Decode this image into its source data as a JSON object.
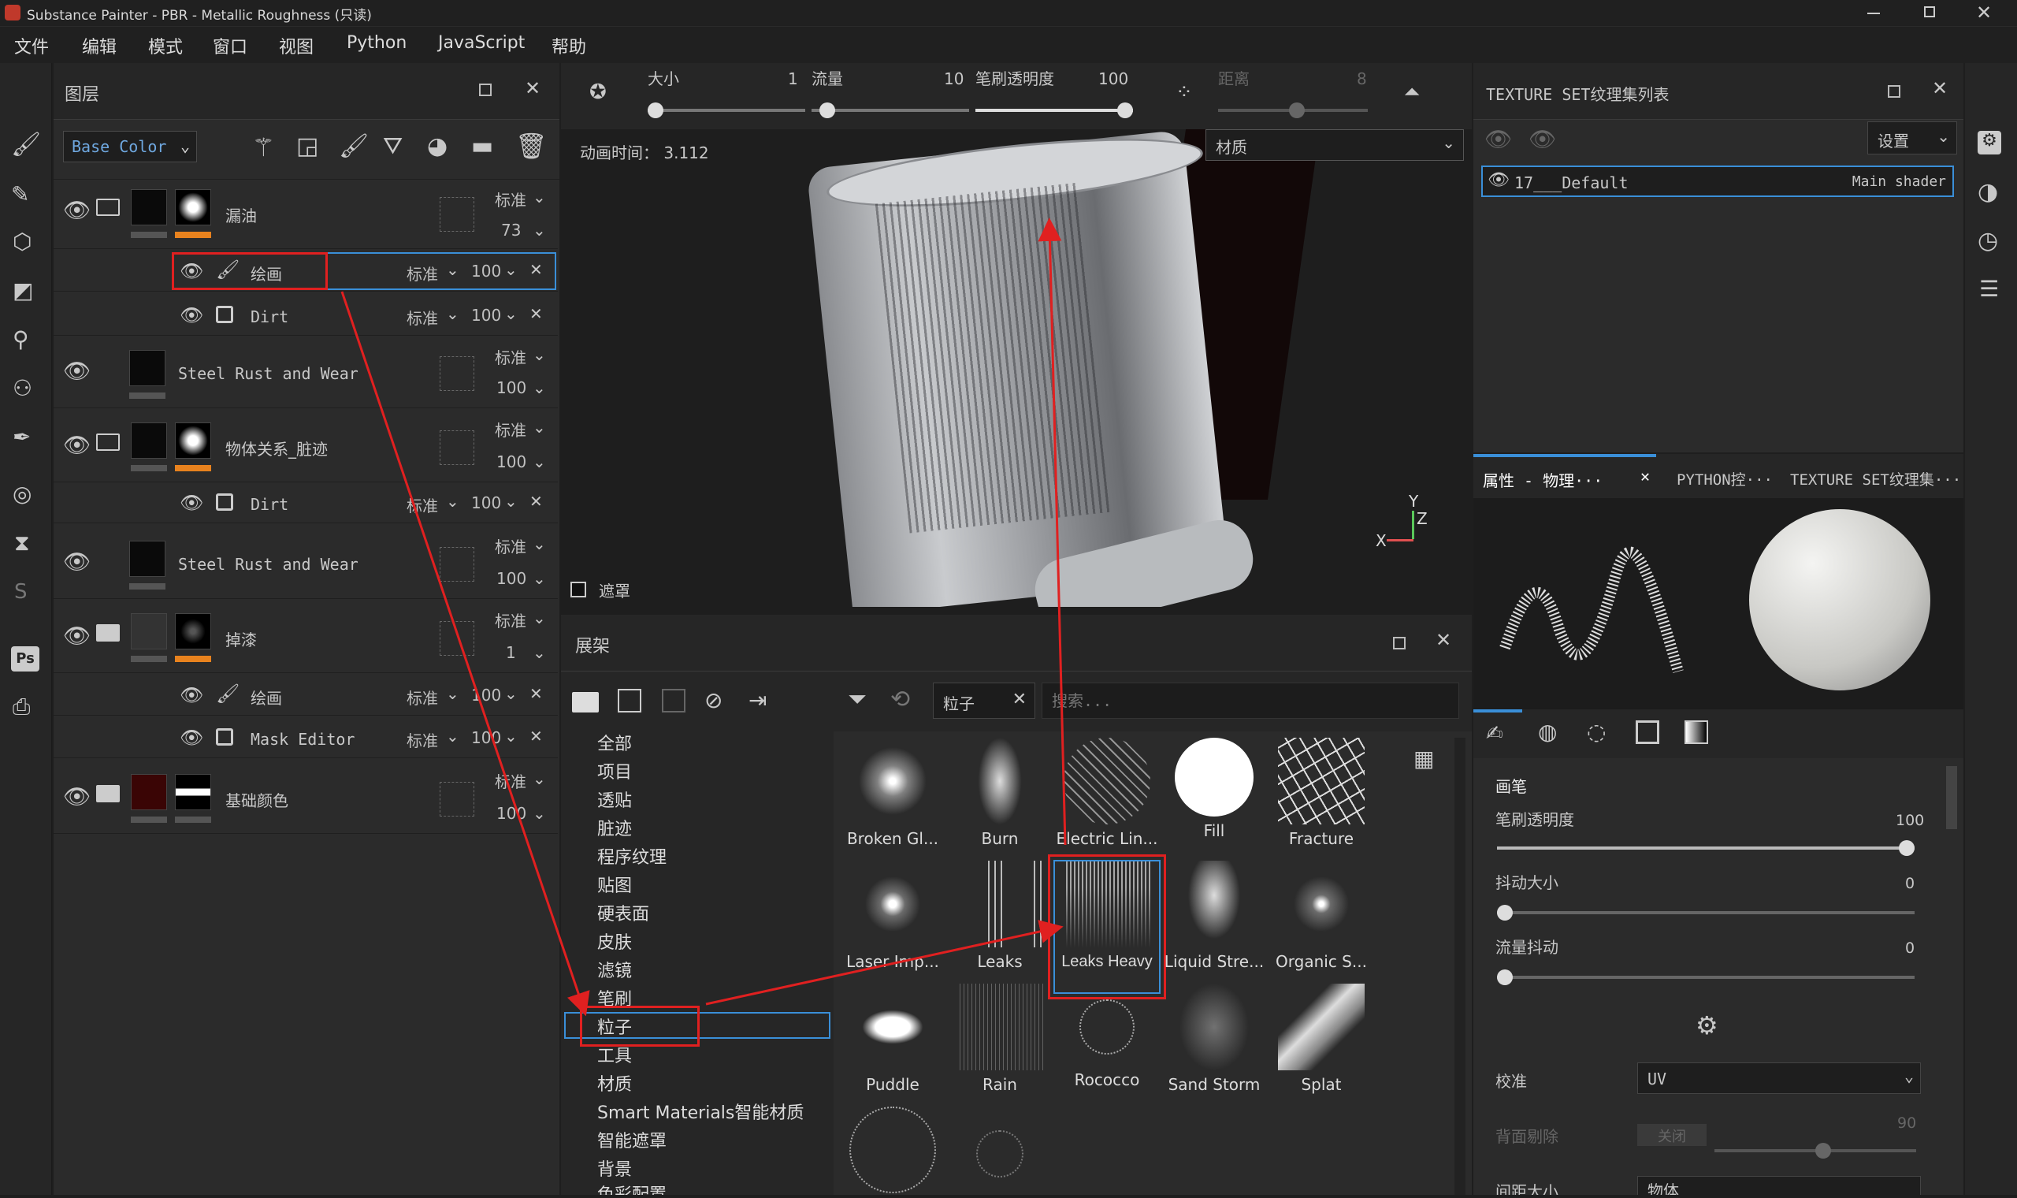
{
  "window": {
    "title": "Substance Painter - PBR - Metallic Roughness (只读)"
  },
  "menu": [
    "文件",
    "编辑",
    "模式",
    "窗口",
    "视图",
    "Python",
    "JavaScript",
    "帮助"
  ],
  "layers_panel": {
    "title": "图层",
    "channel": "Base Color",
    "layers": [
      {
        "name": "漏油",
        "blend": "标准",
        "opacity": "73"
      },
      {
        "name": "绘画",
        "blend": "标准",
        "opacity": "100"
      },
      {
        "name": "Dirt",
        "blend": "标准",
        "opacity": "100"
      },
      {
        "name": "Steel Rust and Wear",
        "blend": "标准",
        "opacity": "100"
      },
      {
        "name": "物体关系_脏迹",
        "blend": "标准",
        "opacity": "100"
      },
      {
        "name": "Dirt",
        "blend": "标准",
        "opacity": "100"
      },
      {
        "name": "Steel Rust and Wear",
        "blend": "标准",
        "opacity": "100"
      },
      {
        "name": "掉漆",
        "blend": "标准",
        "opacity": "1"
      },
      {
        "name": "绘画",
        "blend": "标准",
        "opacity": "100"
      },
      {
        "name": "Mask Editor",
        "blend": "标准",
        "opacity": "100"
      },
      {
        "name": "基础颜色",
        "blend": "标准",
        "opacity": "100"
      }
    ]
  },
  "toolbar": {
    "size_label": "大小",
    "size_val": "1",
    "flow_label": "流量",
    "flow_val": "10",
    "opacity_label": "笔刷透明度",
    "opacity_val": "100",
    "distance_label": "距离",
    "distance_val": "8"
  },
  "viewport": {
    "anim_time": "动画时间： 3.112",
    "material_dropdown": "材质",
    "mask_label": "遮罩",
    "axis_y": "Y",
    "axis_z": "Z",
    "axis_x": "X"
  },
  "shelf": {
    "title": "展架",
    "filter_tag": "粒子",
    "search_placeholder": "搜索...",
    "categories": [
      "全部",
      "项目",
      "透贴",
      "脏迹",
      "程序纹理",
      "贴图",
      "硬表面",
      "皮肤",
      "滤镜",
      "笔刷",
      "粒子",
      "工具",
      "材质",
      "Smart Materials智能材质",
      "智能遮罩",
      "背景",
      "色彩配置"
    ],
    "items": [
      "Broken Gl...",
      "Burn",
      "Electric Lin...",
      "Fill",
      "Fracture",
      "Laser Imp...",
      "Leaks",
      "Leaks Heavy",
      "Liquid Stre...",
      "Organic S...",
      "Puddle",
      "Rain",
      "Rococco",
      "Sand Storm",
      "Splat"
    ]
  },
  "texture_sets": {
    "title": "TEXTURE SET纹理集列表",
    "settings": "设置",
    "item_name": "17___Default",
    "item_shader": "Main shader"
  },
  "props": {
    "tabs": [
      "属性 - 物理···",
      "PYTHON控···",
      "TEXTURE SET纹理集···"
    ],
    "section": "画笔",
    "opacity_label": "笔刷透明度",
    "opacity_val": "100",
    "jitter_label": "抖动大小",
    "jitter_val": "0",
    "flow_jitter_label": "流量抖动",
    "flow_jitter_val": "0",
    "align_label": "校准",
    "align_val": "UV",
    "backface_label": "背面剔除",
    "backface_val": "关闭",
    "backface_num": "90",
    "spacing_label": "间距大小",
    "spacing_val": "物体"
  }
}
